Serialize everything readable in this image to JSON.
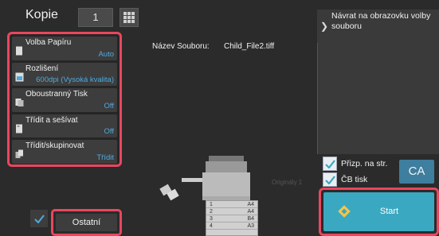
{
  "header": {
    "title": "Kopie",
    "copies": "1"
  },
  "menu": {
    "items": [
      {
        "label": "Volba Papíru",
        "value": "Auto",
        "icon": "paper-select-icon"
      },
      {
        "label": "Rozlišení",
        "value": "600dpi (Vysoká kvalita)",
        "icon": "resolution-icon"
      },
      {
        "label": "Oboustranný Tisk",
        "value": "Off",
        "icon": "duplex-icon"
      },
      {
        "label": "Třídit a sešívat",
        "value": "Off",
        "icon": "sort-staple-icon"
      },
      {
        "label": "Třídit/skupinovat",
        "value": "Třídit",
        "icon": "sort-group-icon"
      }
    ]
  },
  "file": {
    "label": "Název Souboru:",
    "value": "Child_File2.tiff"
  },
  "back": {
    "text": "Návrat na obrazovku volby souboru"
  },
  "options": {
    "fit_label": "Přizp. na str.",
    "bw_label": "ČB tisk"
  },
  "ca": {
    "label": "CA"
  },
  "machine": {
    "originals_label": "Originály 1",
    "trays": [
      {
        "num": "1",
        "size": "A4"
      },
      {
        "num": "2",
        "size": "A4"
      },
      {
        "num": "3",
        "size": "B4"
      },
      {
        "num": "4",
        "size": "A3"
      }
    ]
  },
  "start": {
    "label": "Start"
  },
  "other": {
    "label": "Ostatní"
  },
  "colors": {
    "accent": "#3aa8c0",
    "highlight": "#e8475f",
    "value_blue": "#4fa9dd"
  }
}
